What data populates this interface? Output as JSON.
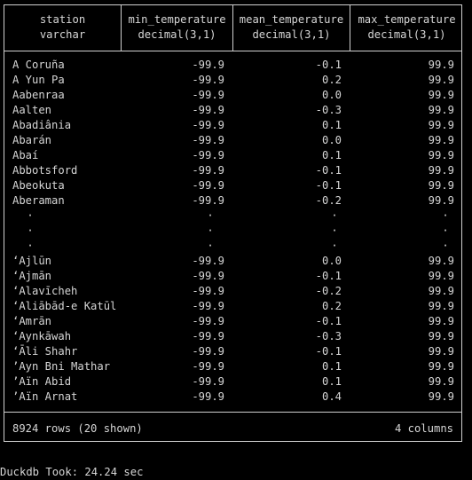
{
  "table": {
    "headers": [
      {
        "name": "station",
        "type": "varchar"
      },
      {
        "name": "min_temperature",
        "type": "decimal(3,1)"
      },
      {
        "name": "mean_temperature",
        "type": "decimal(3,1)"
      },
      {
        "name": "max_temperature",
        "type": "decimal(3,1)"
      }
    ],
    "top_rows": [
      [
        "A Coruña",
        "-99.9",
        "-0.1",
        "99.9"
      ],
      [
        "A Yun Pa",
        "-99.9",
        "0.2",
        "99.9"
      ],
      [
        "Aabenraa",
        "-99.9",
        "0.0",
        "99.9"
      ],
      [
        "Aalten",
        "-99.9",
        "-0.3",
        "99.9"
      ],
      [
        "Abadiânia",
        "-99.9",
        "0.1",
        "99.9"
      ],
      [
        "Abarán",
        "-99.9",
        "0.0",
        "99.9"
      ],
      [
        "Abaí",
        "-99.9",
        "0.1",
        "99.9"
      ],
      [
        "Abbotsford",
        "-99.9",
        "-0.1",
        "99.9"
      ],
      [
        "Abeokuta",
        "-99.9",
        "-0.1",
        "99.9"
      ],
      [
        "Aberaman",
        "-99.9",
        "-0.2",
        "99.9"
      ]
    ],
    "ellipsis": [
      "·",
      "·",
      "·"
    ],
    "bottom_rows": [
      [
        "ʻAjlūn",
        "-99.9",
        "0.0",
        "99.9"
      ],
      [
        "ʻAjmān",
        "-99.9",
        "-0.1",
        "99.9"
      ],
      [
        "ʻAlavīcheh",
        "-99.9",
        "-0.2",
        "99.9"
      ],
      [
        "ʻAliābād-e Katūl",
        "-99.9",
        "0.2",
        "99.9"
      ],
      [
        "ʻAmrān",
        "-99.9",
        "-0.1",
        "99.9"
      ],
      [
        "ʻAynkāwah",
        "-99.9",
        "-0.3",
        "99.9"
      ],
      [
        "ʻĀli Shahr",
        "-99.9",
        "-0.1",
        "99.9"
      ],
      [
        "’Ayn Bni Mathar",
        "-99.9",
        "0.1",
        "99.9"
      ],
      [
        "’Aïn Abid",
        "-99.9",
        "0.1",
        "99.9"
      ],
      [
        "’Aïn Arnat",
        "-99.9",
        "0.4",
        "99.9"
      ]
    ],
    "footer": {
      "rows_info": "8924 rows (20 shown)",
      "columns_info": "4 columns"
    }
  },
  "status": {
    "took": "Duckdb Took: 24.24 sec"
  },
  "colors": {
    "background": "#000000",
    "text": "#d6d6d6",
    "border": "#d0d0d0"
  }
}
